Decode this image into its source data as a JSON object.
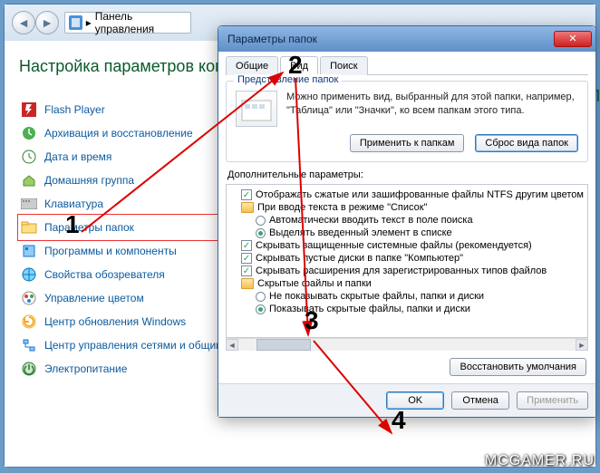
{
  "address_bar": {
    "label": "Панель управления",
    "sep": "▸"
  },
  "cp": {
    "title": "Настройка параметров компьютера",
    "items": [
      {
        "label": "Flash Player",
        "icon": "flash"
      },
      {
        "label": "Архивация и восстановление",
        "icon": "backup"
      },
      {
        "label": "Дата и время",
        "icon": "clock"
      },
      {
        "label": "Домашняя группа",
        "icon": "homegroup"
      },
      {
        "label": "Клавиатура",
        "icon": "keyboard"
      },
      {
        "label": "Параметры папок",
        "icon": "folder-options"
      },
      {
        "label": "Программы и компоненты",
        "icon": "programs"
      },
      {
        "label": "Свойства обозревателя",
        "icon": "internet"
      },
      {
        "label": "Управление цветом",
        "icon": "color"
      },
      {
        "label": "Центр обновления Windows",
        "icon": "update"
      },
      {
        "label": "Центр управления сетями и общим доступом",
        "icon": "network"
      },
      {
        "label": "Электропитание",
        "icon": "power"
      }
    ]
  },
  "other_title": "П",
  "dialog": {
    "title": "Параметры папок",
    "tabs": {
      "general": "Общие",
      "view": "Вид",
      "search": "Поиск"
    },
    "group_title": "Представление папок",
    "desc": "Можно применить вид, выбранный для этой папки, например, \"Таблица\" или \"Значки\", ко всем папкам этого типа.",
    "apply_to_folders": "Применить к папкам",
    "reset_folders": "Сброс вида папок",
    "adv_label": "Дополнительные параметры:",
    "tree": {
      "i0": "Отображать сжатые или зашифрованные файлы NTFS другим цветом",
      "i1": "При вводе текста в режиме \"Список\"",
      "i1a": "Автоматически вводить текст в поле поиска",
      "i1b": "Выделять введенный элемент в списке",
      "i2": "Скрывать защищенные системные файлы (рекомендуется)",
      "i3": "Скрывать пустые диски в папке \"Компьютер\"",
      "i4": "Скрывать расширения для зарегистрированных типов файлов",
      "i5": "Скрытые файлы и папки",
      "i5a": "Не показывать скрытые файлы, папки и диски",
      "i5b": "Показывать скрытые файлы, папки и диски"
    },
    "restore": "Восстановить умолчания",
    "ok": "OK",
    "cancel": "Отмена",
    "apply": "Применить"
  },
  "annotations": {
    "n1": "1",
    "n2": "2",
    "n3": "3",
    "n4": "4"
  },
  "watermark": "MCGAMER.RU"
}
